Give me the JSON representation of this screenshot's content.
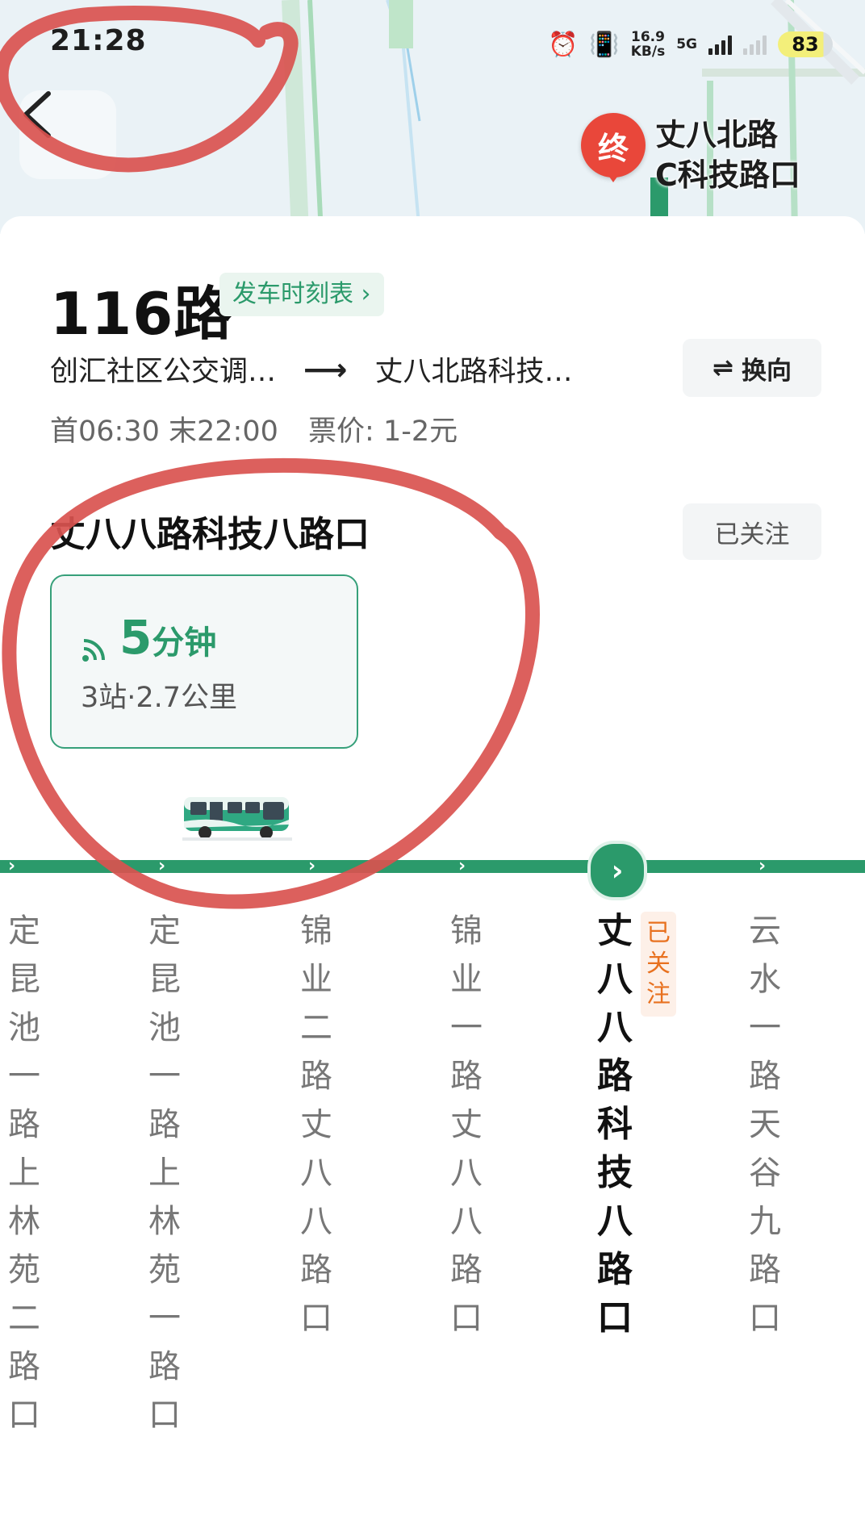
{
  "status_bar": {
    "time": "21:28",
    "net_speed_top": "16.9",
    "net_speed_unit": "KB/s",
    "network_type": "5G",
    "battery": "83",
    "icons": [
      "alarm-icon",
      "vibrate-icon",
      "signal-icon",
      "battery-icon"
    ]
  },
  "map": {
    "end_marker": "终",
    "end_label_line1": "丈八北路",
    "end_label_line2": "C科技路口"
  },
  "route": {
    "title": "116路",
    "timetable_label": "发车时刻表",
    "timetable_chevron": "›",
    "from": "创汇社区公交调…",
    "arrow": "⟶",
    "to": "丈八北路科技…",
    "switch_label": "换向",
    "switch_icon": "⇌",
    "first_bus": "首06:30",
    "last_bus": "末22:00",
    "fare": "票价: 1-2元"
  },
  "selected_stop": {
    "name": "丈八八路科技八路口",
    "follow_label": "已关注"
  },
  "arrival": {
    "minutes": "5",
    "unit": "分钟",
    "detail": "3站·2.7公里"
  },
  "stops": [
    {
      "name": "定昆池一路上林苑二路口"
    },
    {
      "name": "定昆池一路上林苑一路口"
    },
    {
      "name": "锦业二路丈八八路口"
    },
    {
      "name": "锦业一路丈八八路口"
    },
    {
      "name": "丈八八路科技八路口",
      "current": true,
      "tag": "已关注"
    },
    {
      "name": "云水一路天谷九路口"
    }
  ],
  "colors": {
    "accent": "#2b9a6b",
    "end_marker": "#e9473a",
    "tag_orange": "#e8711f",
    "annotation": "#d9534f"
  }
}
